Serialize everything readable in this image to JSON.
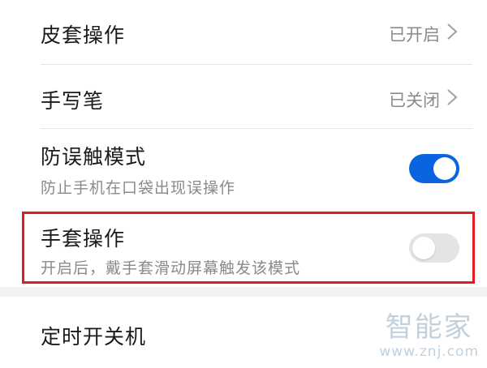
{
  "settings": {
    "items": [
      {
        "title": "皮套操作",
        "value": "已开启"
      },
      {
        "title": "手写笔",
        "value": "已关闭"
      },
      {
        "title": "防误触模式",
        "subtitle": "防止手机在口袋出现误操作",
        "toggle": "on"
      },
      {
        "title": "手套操作",
        "subtitle": "开启后，戴手套滑动屏幕触发该模式",
        "toggle": "off"
      },
      {
        "title": "定时开关机"
      }
    ]
  },
  "watermark": {
    "brand": "智能家",
    "url": "www.znj.com"
  },
  "colors": {
    "toggle_on": "#0a64e0",
    "toggle_off": "#e4e4e4",
    "highlight_border": "#e01b22",
    "secondary_text": "#8a8a8a"
  },
  "icons": {
    "chevron": "chevron-right-icon"
  }
}
